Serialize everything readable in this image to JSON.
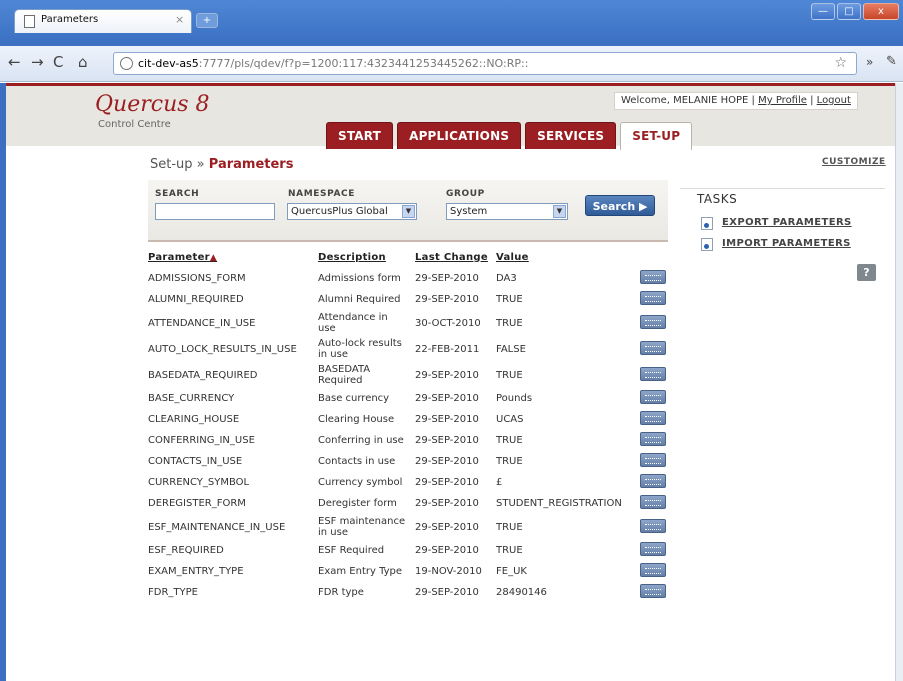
{
  "browser": {
    "tab_title": "Parameters",
    "tab_close": "×",
    "newtab": "+",
    "url_host": "cit-dev-as5",
    "url_rest": ":7777/pls/qdev/f?p=1200:117:4323441253445262::NO:RP::",
    "window": {
      "minimize": "—",
      "maximize": "□",
      "close": "x"
    }
  },
  "header": {
    "logo": "Quercus 8",
    "logo_sub": "Control Centre",
    "welcome": "Welcome, MELANIE HOPE |",
    "my_profile": "My Profile",
    "sep": "|",
    "logout": "Logout",
    "tabs": [
      {
        "label": "START"
      },
      {
        "label": "APPLICATIONS"
      },
      {
        "label": "SERVICES"
      },
      {
        "label": "SET-UP"
      }
    ]
  },
  "breadcrumb": {
    "parent": "Set-up",
    "sep": "»",
    "current": "Parameters"
  },
  "customize": "CUSTOMIZE",
  "search": {
    "search_label": "SEARCH",
    "search_value": "",
    "namespace_label": "NAMESPACE",
    "namespace_value": "QuercusPlus Global",
    "group_label": "GROUP",
    "group_value": "System",
    "button_label": "Search ▶"
  },
  "table": {
    "columns": [
      "Parameter",
      "Description",
      "Last Change",
      "Value"
    ],
    "sort_indicator": "▲",
    "rows": [
      {
        "parameter": "ADMISSIONS_FORM",
        "description": "Admissions form",
        "last_change": "29-SEP-2010",
        "value": "DA3"
      },
      {
        "parameter": "ALUMNI_REQUIRED",
        "description": "Alumni Required",
        "last_change": "29-SEP-2010",
        "value": "TRUE"
      },
      {
        "parameter": "ATTENDANCE_IN_USE",
        "description": "Attendance in use",
        "last_change": "30-OCT-2010",
        "value": "TRUE"
      },
      {
        "parameter": "AUTO_LOCK_RESULTS_IN_USE",
        "description": "Auto-lock results in use",
        "last_change": "22-FEB-2011",
        "value": "FALSE"
      },
      {
        "parameter": "BASEDATA_REQUIRED",
        "description": "BASEDATA Required",
        "last_change": "29-SEP-2010",
        "value": "TRUE"
      },
      {
        "parameter": "BASE_CURRENCY",
        "description": "Base currency",
        "last_change": "29-SEP-2010",
        "value": "Pounds"
      },
      {
        "parameter": "CLEARING_HOUSE",
        "description": "Clearing House",
        "last_change": "29-SEP-2010",
        "value": "UCAS"
      },
      {
        "parameter": "CONFERRING_IN_USE",
        "description": "Conferring in use",
        "last_change": "29-SEP-2010",
        "value": "TRUE"
      },
      {
        "parameter": "CONTACTS_IN_USE",
        "description": "Contacts in use",
        "last_change": "29-SEP-2010",
        "value": "TRUE"
      },
      {
        "parameter": "CURRENCY_SYMBOL",
        "description": "Currency symbol",
        "last_change": "29-SEP-2010",
        "value": "£"
      },
      {
        "parameter": "DEREGISTER_FORM",
        "description": "Deregister form",
        "last_change": "29-SEP-2010",
        "value": "STUDENT_REGISTRATION"
      },
      {
        "parameter": "ESF_MAINTENANCE_IN_USE",
        "description": "ESF maintenance in use",
        "last_change": "29-SEP-2010",
        "value": "TRUE"
      },
      {
        "parameter": "ESF_REQUIRED",
        "description": "ESF Required",
        "last_change": "29-SEP-2010",
        "value": "TRUE"
      },
      {
        "parameter": "EXAM_ENTRY_TYPE",
        "description": "Exam Entry Type",
        "last_change": "19-NOV-2010",
        "value": "FE_UK"
      },
      {
        "parameter": "FDR_TYPE",
        "description": "FDR type",
        "last_change": "29-SEP-2010",
        "value": "28490146"
      }
    ]
  },
  "tasks": {
    "title": "TASKS",
    "items": [
      {
        "label": "EXPORT PARAMETERS"
      },
      {
        "label": "IMPORT PARAMETERS"
      }
    ],
    "help": "?"
  }
}
